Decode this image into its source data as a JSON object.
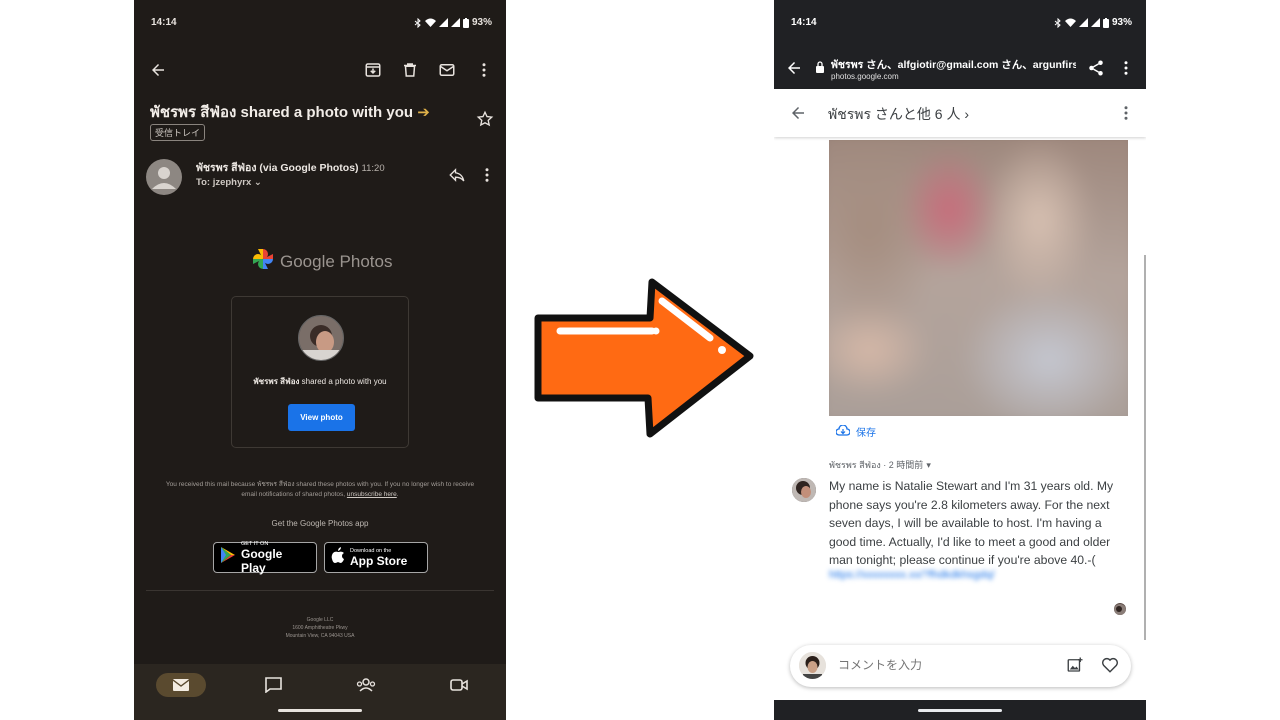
{
  "left": {
    "status": {
      "time": "14:14",
      "battery": "93%"
    },
    "subject": "พัชรพร สีฟ่อง shared a photo with you",
    "label_chip": "受信トレイ",
    "sender": {
      "name": "พัชรพร สีฟ่อง (via Google Photos)",
      "time": "11:20",
      "to": "To: jzephyrx"
    },
    "brand": "Google Photos",
    "card": {
      "name": "พัชรพร สีฟ่อง",
      "text": " shared a photo with you",
      "button": "View photo"
    },
    "footer": {
      "line1": "You received this mail because พัชรพร สีฟ่อง shared these photos with you. If you no longer wish to receive",
      "line2a": "email notifications of shared photos, ",
      "unsubscribe": "unsubscribe here",
      "line2b": "."
    },
    "get_app": "Get the Google Photos app",
    "google_play": {
      "small": "GET IT ON",
      "big": "Google Play"
    },
    "app_store": {
      "small": "Download on the",
      "big": "App Store"
    },
    "address": [
      "Google LLC",
      "1600 Amphitheatre Pkwy",
      "Mountain View, CA 94043 USA"
    ],
    "nav": [
      "mail-icon",
      "chat-icon",
      "spaces-icon",
      "meet-icon"
    ],
    "colors": {
      "accent": "#1a73e8",
      "bg": "#1f1b18",
      "label_tag": "#e0b24a"
    }
  },
  "right": {
    "status": {
      "time": "14:14",
      "battery": "93%"
    },
    "browser": {
      "title": "พัชรพร さん、alfgiotir@gmail.com さん、argunfirst",
      "host": "photos.google.com"
    },
    "album_title": "พัชรพร さんと他 6 人",
    "save_label": "保存",
    "comment_meta": "พัชรพร สีฟ่อง · 2 時間前",
    "comment_text": "My name is Natalie Stewart and I'm 31 years old. My phone says you're 2.8 kilometers away. For the next seven days, I will be available to host. I'm having a good time. Actually, I'd like to meet a good and older man tonight; please continue if you're above 40.-(",
    "comment_link": "https://xxxxxxxx.xx/?fhdkdkhsgdq/ ",
    "input_placeholder": "コメントを入力",
    "colors": {
      "accent": "#1a73e8",
      "toolbar": "#202124"
    }
  },
  "arrow": {
    "color": "#ff6a13",
    "direction": "right"
  }
}
